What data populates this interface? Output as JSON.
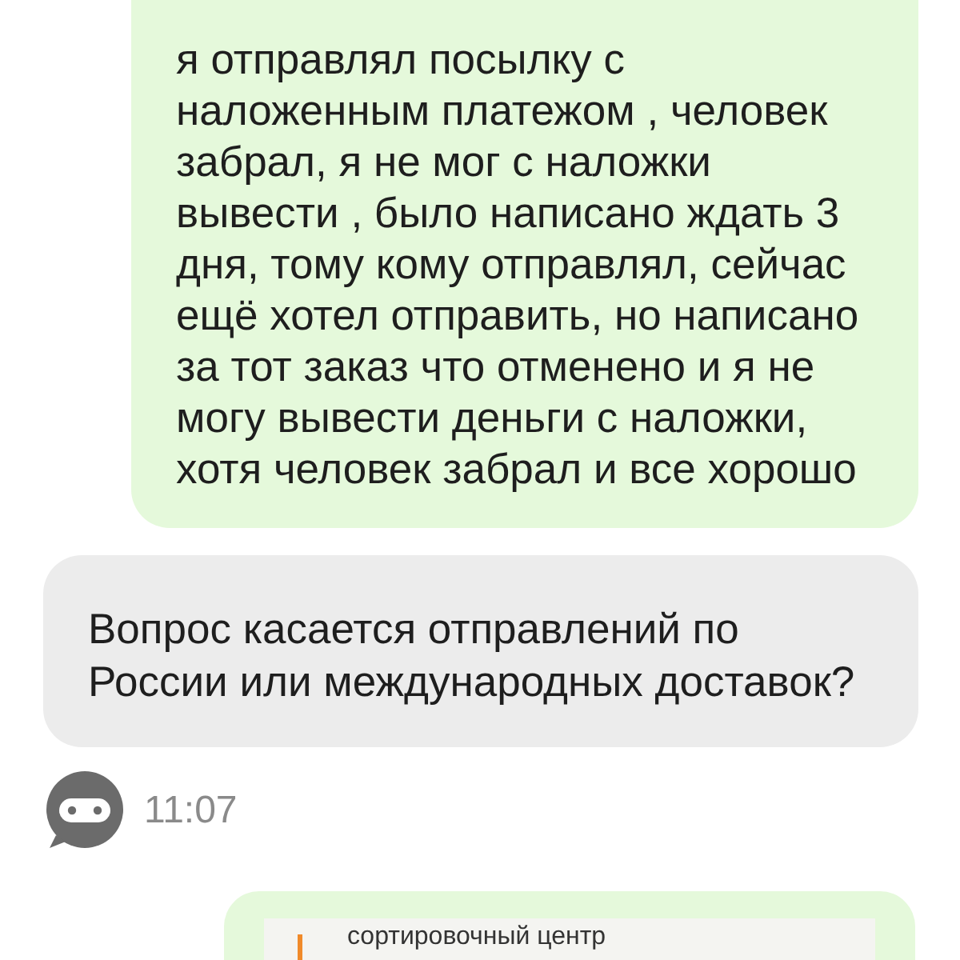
{
  "chat": {
    "messages": [
      {
        "kind": "outgoing",
        "text": "я отправлял посылку с наложенным платежом , человек забрал, я не мог с наложки вывести , было написано ждать 3 дня, тому кому отправлял, сейчас ещё хотел отправить, но написано за тот заказ что отменено и я не могу вывести деньги с наложки, хотя человек забрал и все хорошо"
      },
      {
        "kind": "incoming",
        "text": "Вопрос касается отправлений по России или международных доставок?",
        "time": "11:07"
      },
      {
        "kind": "outgoing_card",
        "quote": "сортировочный центр"
      }
    ]
  }
}
